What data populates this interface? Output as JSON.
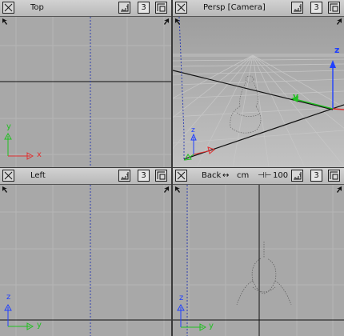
{
  "viewports": {
    "top": {
      "title": "Top",
      "camera_count": "3"
    },
    "persp": {
      "title": "Persp [Camera]",
      "camera_count": "3"
    },
    "left": {
      "title": "Left",
      "camera_count": "3"
    },
    "back": {
      "title": "Back",
      "camera_count": "3",
      "units": "cm",
      "zoom": "100"
    }
  },
  "axes": {
    "x": "x",
    "y": "y",
    "z": "z"
  },
  "colors": {
    "viewport_bg": "#a8a8a8",
    "grid": "#b4b4b4",
    "x_axis": "#e03030",
    "y_axis": "#20c020",
    "z_axis": "#2040ff",
    "bounds_dashed": "#3040b0",
    "active_border": "#f2f2f2"
  },
  "icons": [
    "maximize-toggle-icon",
    "ruler-icon",
    "layout-icon",
    "arrow-cursor-icon",
    "resize-corner-icon"
  ]
}
